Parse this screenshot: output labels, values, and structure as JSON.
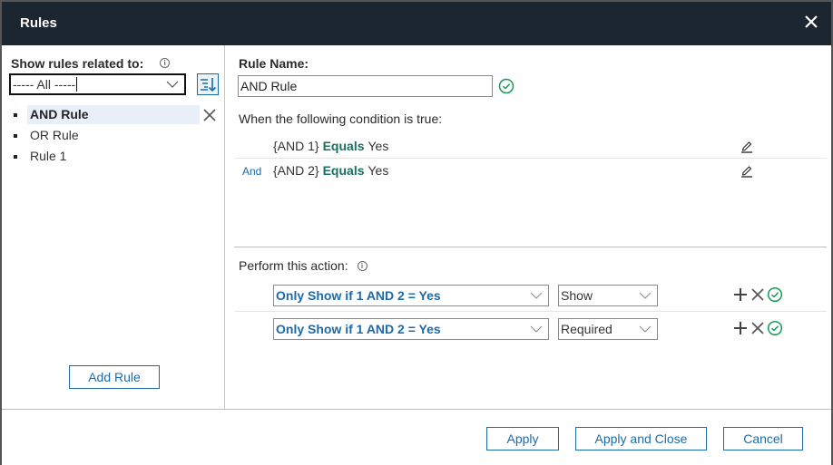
{
  "dialog": {
    "title": "Rules",
    "close_icon": "close-icon"
  },
  "sidebar": {
    "filter_label": "Show rules related to:",
    "filter_info_icon": "info-icon",
    "filter_value": "----- All -----",
    "sort_icon": "sort-descending-icon",
    "rules": [
      {
        "label": "AND Rule",
        "selected": true
      },
      {
        "label": "OR Rule",
        "selected": false
      },
      {
        "label": "Rule 1",
        "selected": false
      }
    ],
    "add_rule_label": "Add Rule"
  },
  "editor": {
    "rule_name_label": "Rule Name:",
    "rule_name_value": "AND Rule",
    "rule_name_valid_icon": "check-circle-icon",
    "condition_label": "When the following condition is true:",
    "conditions": [
      {
        "conjunction": "",
        "field": "{AND 1}",
        "operator": "Equals",
        "value": "Yes"
      },
      {
        "conjunction": "And",
        "field": "{AND 2}",
        "operator": "Equals",
        "value": "Yes"
      }
    ],
    "action_label": "Perform this action:",
    "actions": [
      {
        "target": "Only Show if 1 AND 2 = Yes",
        "action": "Show"
      },
      {
        "target": "Only Show if 1 AND 2 = Yes",
        "action": "Required"
      }
    ]
  },
  "footer": {
    "apply_label": "Apply",
    "apply_close_label": "Apply and Close",
    "cancel_label": "Cancel"
  },
  "colors": {
    "titlebar": "#1c2631",
    "accent_blue": "#1c6aa8",
    "operator_teal": "#177063",
    "valid_green": "#1a9a5a"
  }
}
